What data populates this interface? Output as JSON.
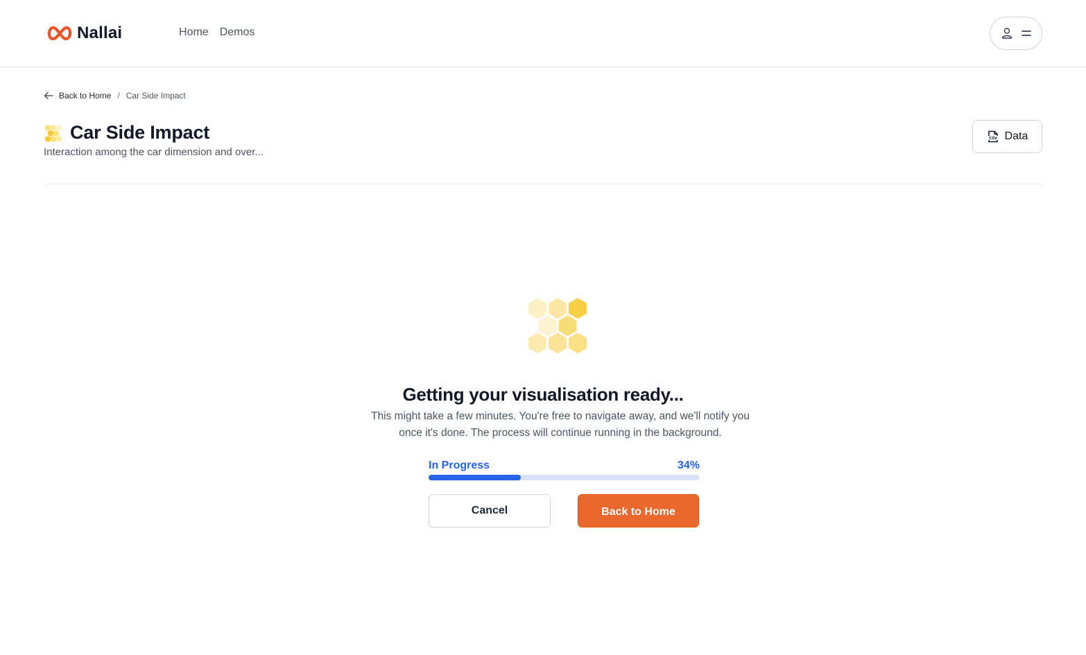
{
  "brand": {
    "name": "Nallai",
    "accent": "#ea672d"
  },
  "nav": {
    "items": [
      {
        "label": "Home"
      },
      {
        "label": "Demos"
      }
    ]
  },
  "user_menu": {
    "icons": [
      "user-icon",
      "menu-icon"
    ]
  },
  "breadcrumb": {
    "back_label": "Back to Home",
    "separator": "/",
    "current": "Car Side Impact"
  },
  "page": {
    "title": "Car Side Impact",
    "subtitle": "Interaction among the car dimension and over...",
    "data_button_label": "Data"
  },
  "loading": {
    "title": "Getting your visualisation ready...",
    "description": "This might take a few minutes. You're free to navigate away, and we'll notify you once it's done. The process will continue running in the background.",
    "status_label": "In Progress",
    "progress_text": "34%",
    "progress_fraction": 0.34,
    "progress_color": "#2563eb",
    "cancel_label": "Cancel",
    "back_home_label": "Back to Home"
  }
}
